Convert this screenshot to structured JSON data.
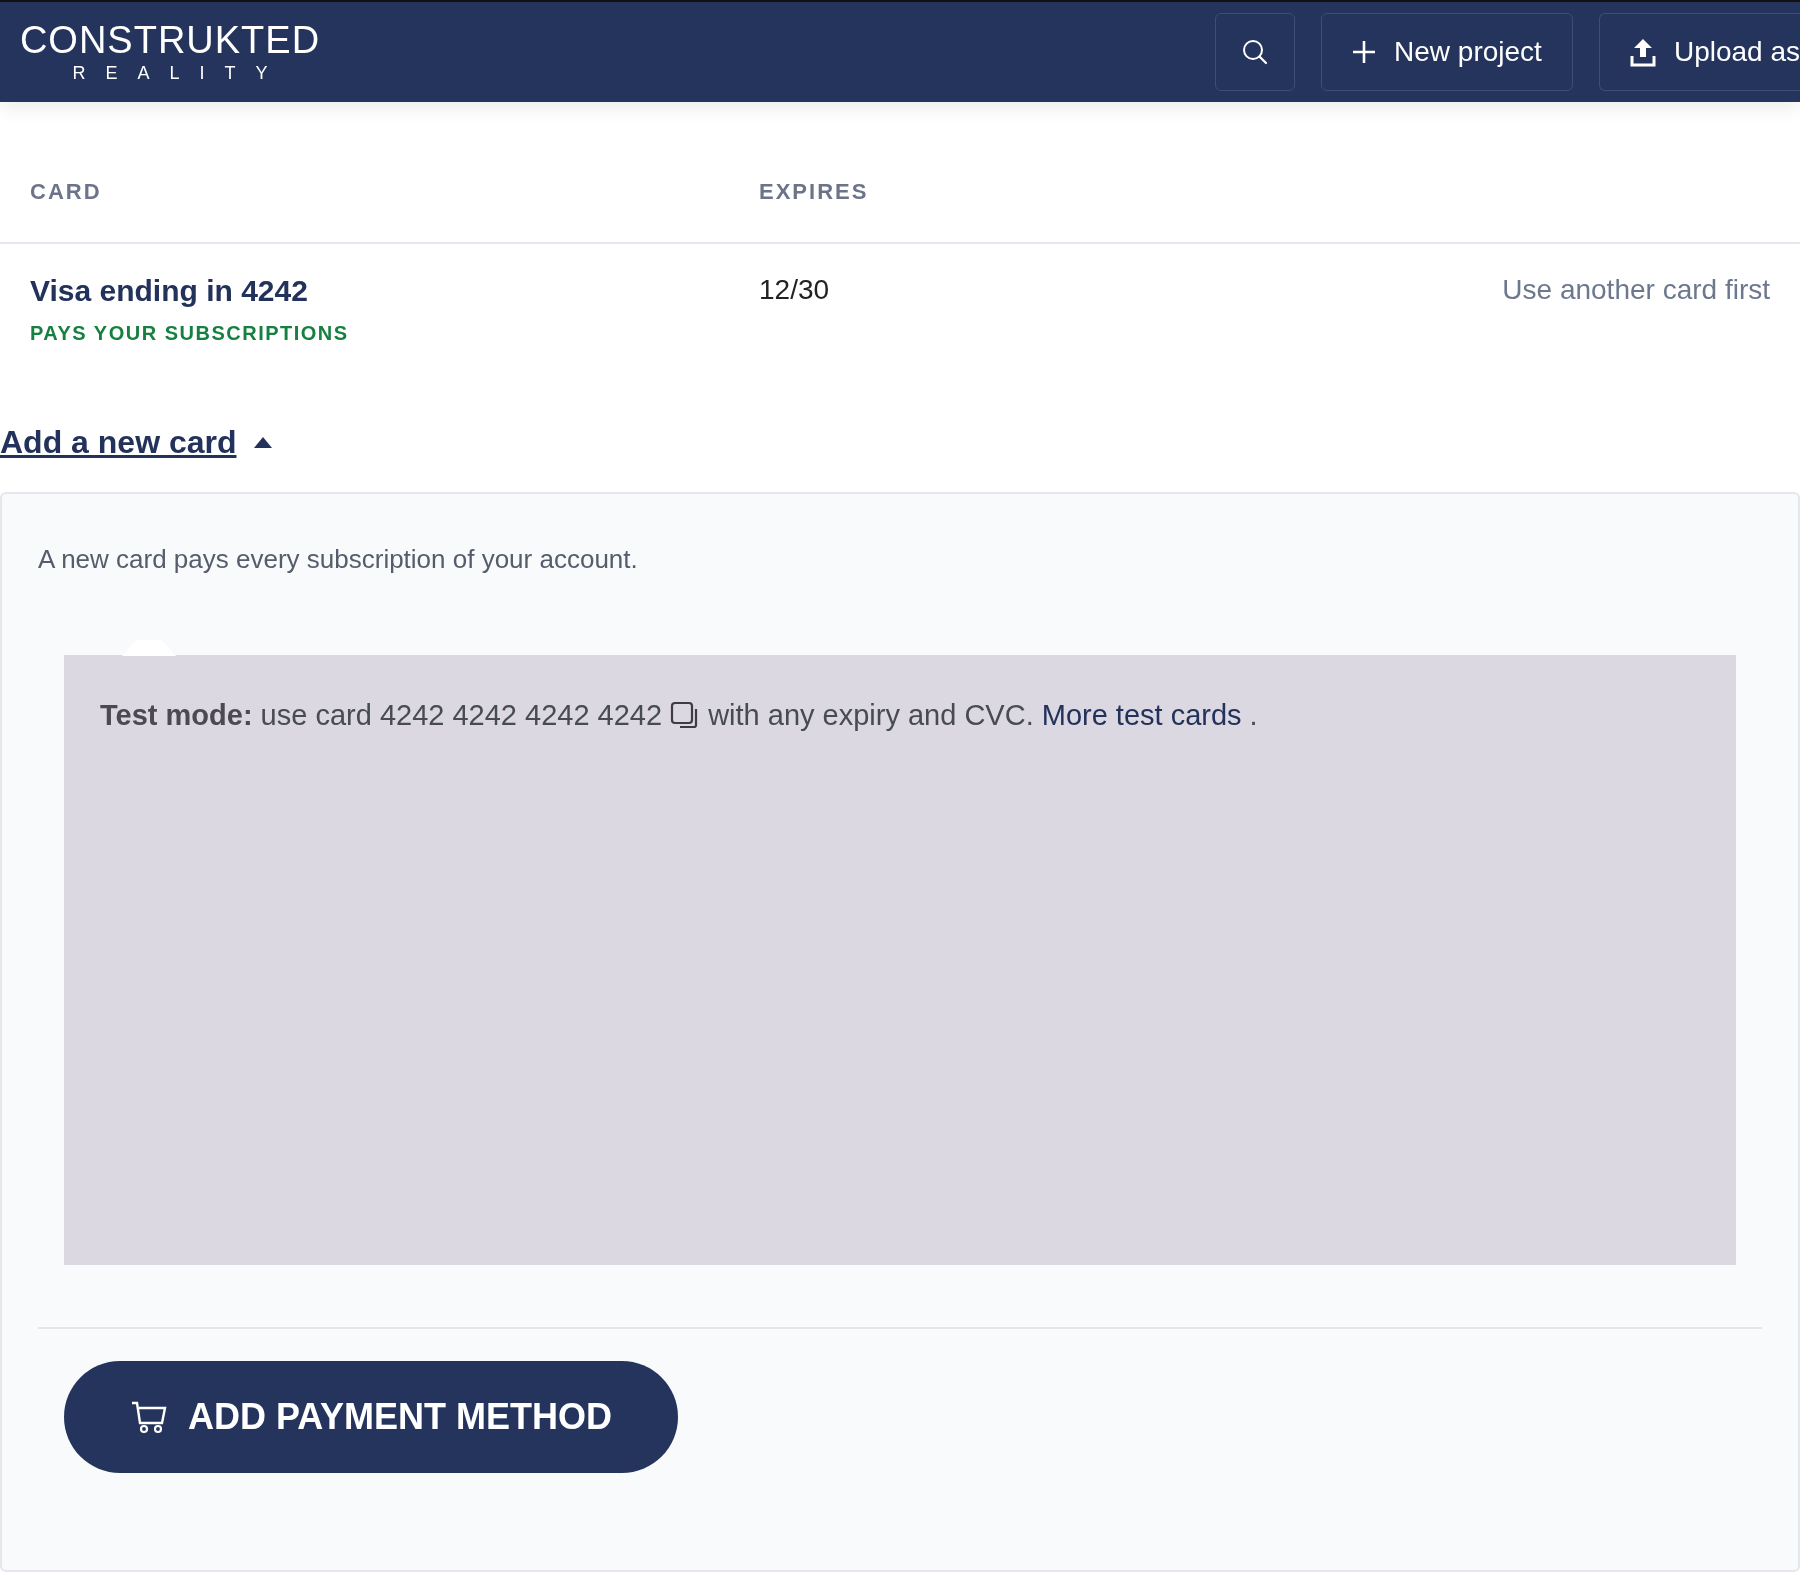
{
  "header": {
    "logo": {
      "main": "CONSTRUKTED",
      "sub": "REALITY"
    },
    "actions": [
      {
        "kind": "search"
      },
      {
        "kind": "new",
        "label": "New project"
      },
      {
        "kind": "upload",
        "label": "Upload as"
      }
    ]
  },
  "table": {
    "columns": [
      "CARD",
      "EXPIRES"
    ],
    "rows": [
      {
        "card": "Visa ending in 4242",
        "tag": "PAYS YOUR SUBSCRIPTIONS",
        "expires": "12/30",
        "action": "Use another card first"
      }
    ]
  },
  "add_card": {
    "toggle": "Add a new card",
    "expanded": true,
    "description": "A new card pays every subscription of your account.",
    "test_notice": {
      "text": "**Test mode:** use card 4242 4242 4242 4242",
      "after": "with any expiry and CVC.",
      "link": "More test cards",
      "end": "."
    },
    "submit": "ADD PAYMENT METHOD"
  }
}
